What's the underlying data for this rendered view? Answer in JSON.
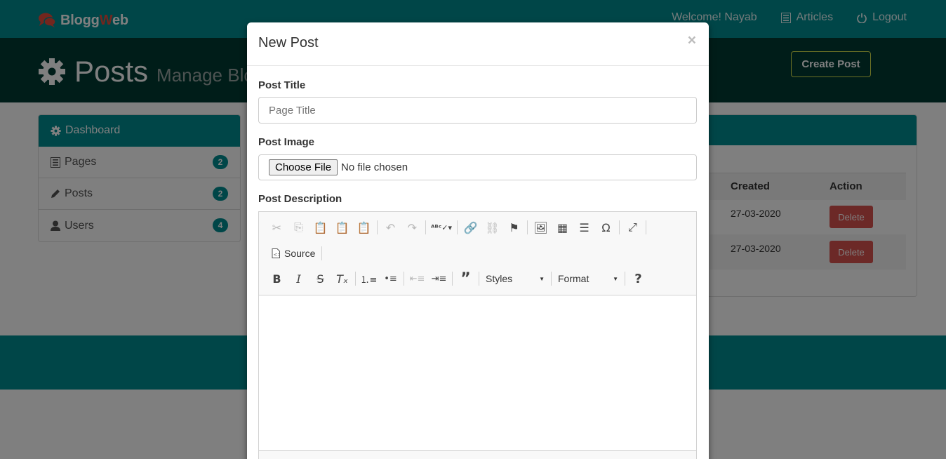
{
  "navbar": {
    "brand_part1": "Blogg",
    "brand_part2": "W",
    "brand_part3": "eb",
    "welcome": "Welcome! Nayab",
    "articles": "Articles",
    "logout": "Logout"
  },
  "header": {
    "title": "Posts",
    "subtitle": "Manage Blo",
    "create_button": "Create Post"
  },
  "sidebar": {
    "items": [
      {
        "label": "Dashboard",
        "icon": "gear-icon",
        "active": true
      },
      {
        "label": "Pages",
        "icon": "list-icon",
        "count": "2"
      },
      {
        "label": "Posts",
        "icon": "pencil-icon",
        "count": "2"
      },
      {
        "label": "Users",
        "icon": "user-icon",
        "count": "4"
      }
    ]
  },
  "table": {
    "headers": {
      "created": "Created",
      "action": "Action"
    },
    "rows": [
      {
        "created": "27-03-2020",
        "action": "Delete"
      },
      {
        "created": "27-03-2020",
        "action": "Delete"
      }
    ]
  },
  "modal": {
    "title": "New Post",
    "close": "×",
    "post_title_label": "Post Title",
    "post_title_placeholder": "Page Title",
    "post_image_label": "Post Image",
    "file_button": "Choose File",
    "file_status": "No file chosen",
    "post_description_label": "Post Description"
  },
  "editor": {
    "source_label": "Source",
    "styles_label": "Styles",
    "format_label": "Format",
    "help_label": "?"
  },
  "colors": {
    "teal": "#008c91",
    "dark_header": "#003b33",
    "danger": "#d9534f",
    "brand_accent": "#e74c3c"
  }
}
